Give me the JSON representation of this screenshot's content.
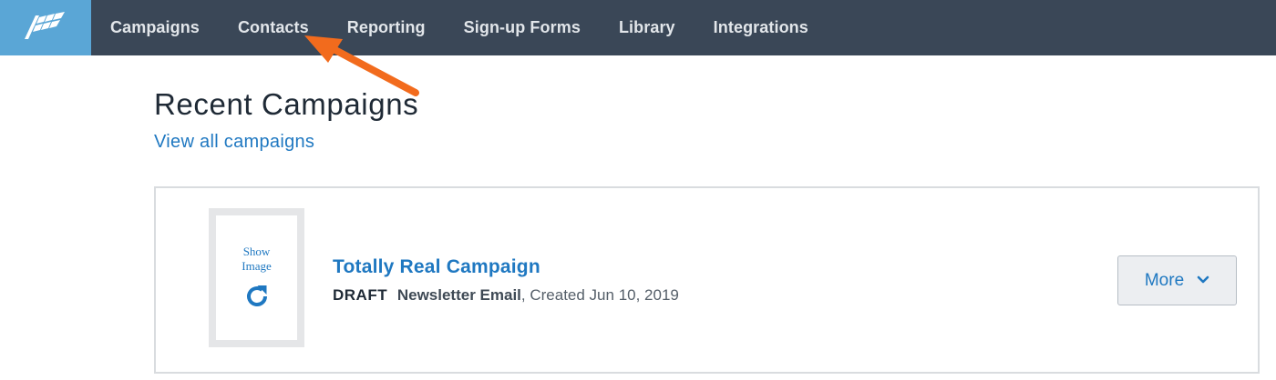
{
  "nav": {
    "items": [
      {
        "label": "Campaigns"
      },
      {
        "label": "Contacts"
      },
      {
        "label": "Reporting"
      },
      {
        "label": "Sign-up Forms"
      },
      {
        "label": "Library"
      },
      {
        "label": "Integrations"
      }
    ]
  },
  "main": {
    "title": "Recent Campaigns",
    "view_all_link": "View all campaigns",
    "campaign": {
      "thumbnail_text": "Show\nImage",
      "title": "Totally Real Campaign",
      "status": "DRAFT",
      "type": "Newsletter Email",
      "created": ", Created Jun 10, 2019",
      "more_label": "More"
    }
  },
  "colors": {
    "topbar": "#3a4757",
    "logo_bg": "#5aa6d6",
    "link": "#1f78c1",
    "annotation_arrow": "#f26b1d"
  },
  "icons": {
    "logo": "flag-logo-icon",
    "refresh": "refresh-icon",
    "chevron": "chevron-down-icon",
    "annotation": "arrow-annotation-icon"
  }
}
